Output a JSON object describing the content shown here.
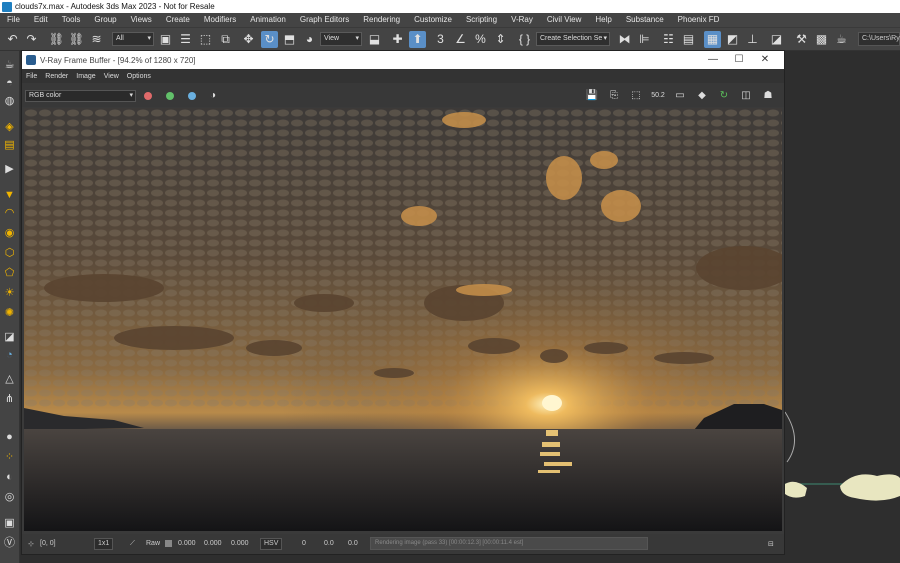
{
  "window": {
    "title": "clouds7x.max - Autodesk 3ds Max 2023 - Not for Resale"
  },
  "menubar": {
    "items": [
      "File",
      "Edit",
      "Tools",
      "Group",
      "Views",
      "Create",
      "Modifiers",
      "Animation",
      "Graph Editors",
      "Rendering",
      "Customize",
      "Scripting",
      "V-Ray",
      "Civil View",
      "Help",
      "Substance",
      "Phoenix FD"
    ]
  },
  "toolbar": {
    "filter_value": "All",
    "view_value": "View",
    "snap_label": "3",
    "selection_set_value": "Create Selection Se",
    "path_value": "C:\\Users\\Rya"
  },
  "vfb": {
    "title": "V-Ray Frame Buffer - [94.2% of 1280 x 720]",
    "menu": [
      "File",
      "Render",
      "Image",
      "View",
      "Options"
    ],
    "channel": "RGB color",
    "status": {
      "coords": "[0, 0]",
      "sample": "1x1",
      "raw_label": "Raw",
      "raw_r": "0.000",
      "raw_g": "0.000",
      "raw_b": "0.000",
      "color_mode": "HSV",
      "h": "0",
      "s": "0.0",
      "v": "0.0",
      "progress_text": "Rendering image (pass 33) [00:00:12.3] [00:00:11.4 est]"
    }
  },
  "colors": {
    "red_channel": "#e06a6a",
    "green_channel": "#62c06a",
    "blue_channel": "#6ab0e0",
    "accent_active": "#5a8fc7"
  }
}
